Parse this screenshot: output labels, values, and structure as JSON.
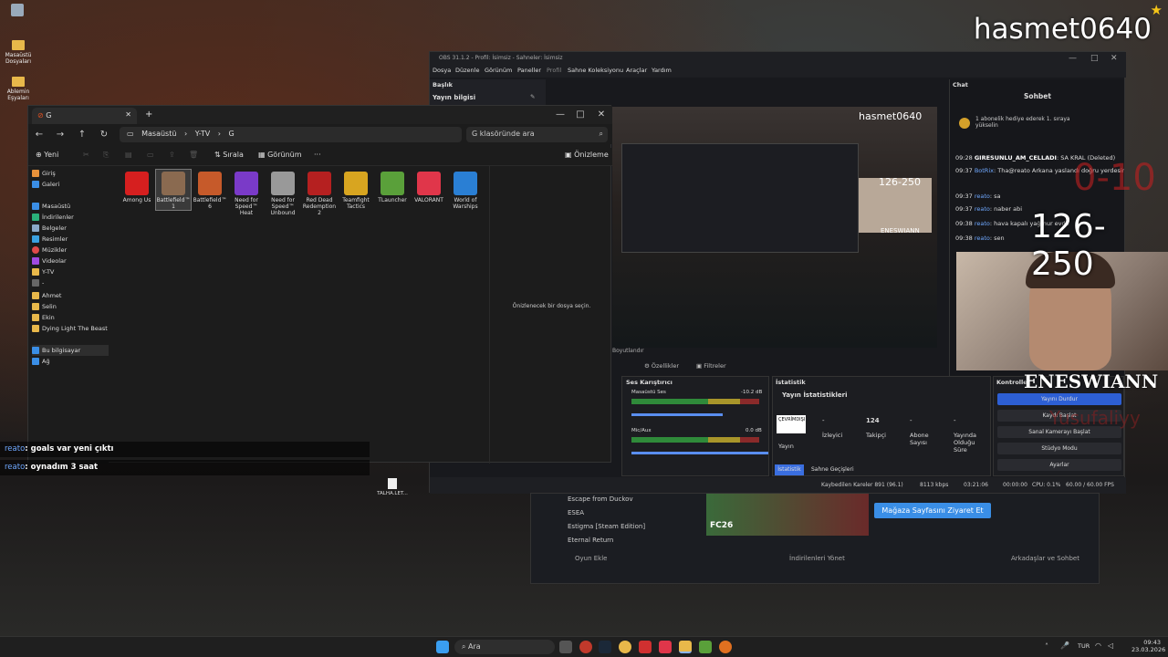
{
  "desktop": {
    "icons": [
      {
        "label": "Masaüstü Dosyaları"
      },
      {
        "label": "Ablemin Eşyaları"
      }
    ],
    "streamer_name": "hasmet0640"
  },
  "explorer": {
    "tab_title": "G",
    "breadcrumb": [
      "Masaüstü",
      "Y-TV",
      "G"
    ],
    "search_placeholder": "G klasöründe ara",
    "commands": {
      "new": "Yeni",
      "sort": "Sırala",
      "view": "Görünüm",
      "more": "···",
      "preview": "Önizleme"
    },
    "sidebar": [
      "Giriş",
      "Galeri",
      "Masaüstü",
      "İndirilenler",
      "Belgeler",
      "Resimler",
      "Müzikler",
      "Videolar",
      "Y-TV",
      "-",
      "Ahmet",
      "Selin",
      "Ekin",
      "Dying Light The Beast",
      "Bu bilgisayar",
      "Ağ"
    ],
    "files": [
      {
        "name": "Among Us",
        "color": "#d61f1f"
      },
      {
        "name": "Battlefield™ 1",
        "color": "#8a6a50"
      },
      {
        "name": "Battlefield™ 6",
        "color": "#c65a2a"
      },
      {
        "name": "Need for Speed™ Heat",
        "color": "#7a3ac8"
      },
      {
        "name": "Need for Speed™ Unbound",
        "color": "#999999"
      },
      {
        "name": "Red Dead Redemption 2",
        "color": "#b52020"
      },
      {
        "name": "Teamfight Tactics",
        "color": "#d8a520"
      },
      {
        "name": "TLauncher",
        "color": "#5aa03a"
      },
      {
        "name": "VALORANT",
        "color": "#e0364a"
      },
      {
        "name": "World of Warships",
        "color": "#2a7fd4"
      }
    ],
    "preview_text": "Önizlenecek bir dosya seçin."
  },
  "obs": {
    "title": "OBS 31.1.2 - Profil: İsimsiz - Sahneler: İsimsiz",
    "menu": [
      "Dosya",
      "Düzenle",
      "Görünüm",
      "Paneller",
      "Profil",
      "Sahne Koleksiyonu",
      "Araçlar",
      "Yardım"
    ],
    "baslik": "Başlık",
    "yayin_bilgisi": "Yayın bilgisi",
    "preview_name": "hasmet0640",
    "scene_label": "Boyutlandır",
    "props": {
      "ozellikler": "Özellikler",
      "filtreler": "Filtreler"
    },
    "mixer": {
      "title": "Ses Karıştırıcı",
      "desktop": "Masaüstü Ses",
      "desktop_db": "-10.2 dB",
      "mic": "Mic/Aux",
      "mic_db": "0.0 dB"
    },
    "stats": {
      "title": "İstatistik",
      "heading": "Yayın İstatistikleri",
      "offline": "ÇEVRİMDIŞI",
      "stream": "Yayın",
      "viewers_val": "-",
      "viewers": "İzleyici",
      "followers_val": "124",
      "followers": "Takipçi",
      "subs_val": "-",
      "subs": "Abone Sayısı",
      "uptime_val": "-",
      "uptime": "Yayında Olduğu Süre",
      "tab1": "İstatistik",
      "tab2": "Sahne Geçişleri"
    },
    "controls": {
      "title": "Kontroller",
      "buttons": [
        "Yayını Durdur",
        "Kaydı Başlat",
        "Sanal Kamerayı Başlat",
        "Stüdyo Modu",
        "Ayarlar"
      ]
    },
    "status": {
      "dropped": "Kaybedilen Kareler 891 (96.1)",
      "kbps": "8113 kbps",
      "time": "03:21:06",
      "rec": "00:00:00",
      "cpu": "CPU: 0.1%",
      "fps": "60.00 / 60.00 FPS"
    },
    "chat": {
      "title": "Chat",
      "header": "Sohbet",
      "gift": "1 abonelik hediye ederek 1. sıraya yükselin",
      "lines": [
        {
          "t": "09:28",
          "u": "GIRESUNLU_AM_CELLADI",
          "m": ": SA KRAL (Deleted)"
        },
        {
          "t": "09:37",
          "u": "BotRix",
          "m": ": Tha@reato Arkana yaslandı doğru yerdesin"
        },
        {
          "t": "09:37",
          "u": "reato",
          "m": ": sa"
        },
        {
          "t": "09:37",
          "u": "reato",
          "m": ": naber abi"
        },
        {
          "t": "09:38",
          "u": "reato",
          "m": ": hava kapalı yağmur evde"
        },
        {
          "t": "09:38",
          "u": "reato",
          "m": ": sen"
        }
      ]
    },
    "overlay": {
      "score": "126-250",
      "score_small": "126-250",
      "red": "0-10",
      "cam_name": "ENESWIANN",
      "cam_name_small": "ENESWIANN",
      "sub": "Yusufaliyy"
    }
  },
  "steam": {
    "games": [
      "Escape from Duckov",
      "ESEA",
      "Estigma [Steam Edition]",
      "Eternal Return"
    ],
    "store_button": "Mağaza Sayfasını Ziyaret Et",
    "add_game": "Oyun Ekle",
    "downloads": "İndirilenleri Yönet",
    "friends": "Arkadaşlar ve Sohbet",
    "banner": "FC26"
  },
  "overlay_chat": [
    {
      "u": "reato",
      "m": ": goals var yeni çıktı"
    },
    {
      "u": "reato",
      "m": ": oynadım 3 saat"
    }
  ],
  "desktop_file": "TALHA.LET...",
  "taskbar": {
    "search": "Ara",
    "lang": "TUR",
    "time": "09:43",
    "date": "23.03.2026"
  }
}
